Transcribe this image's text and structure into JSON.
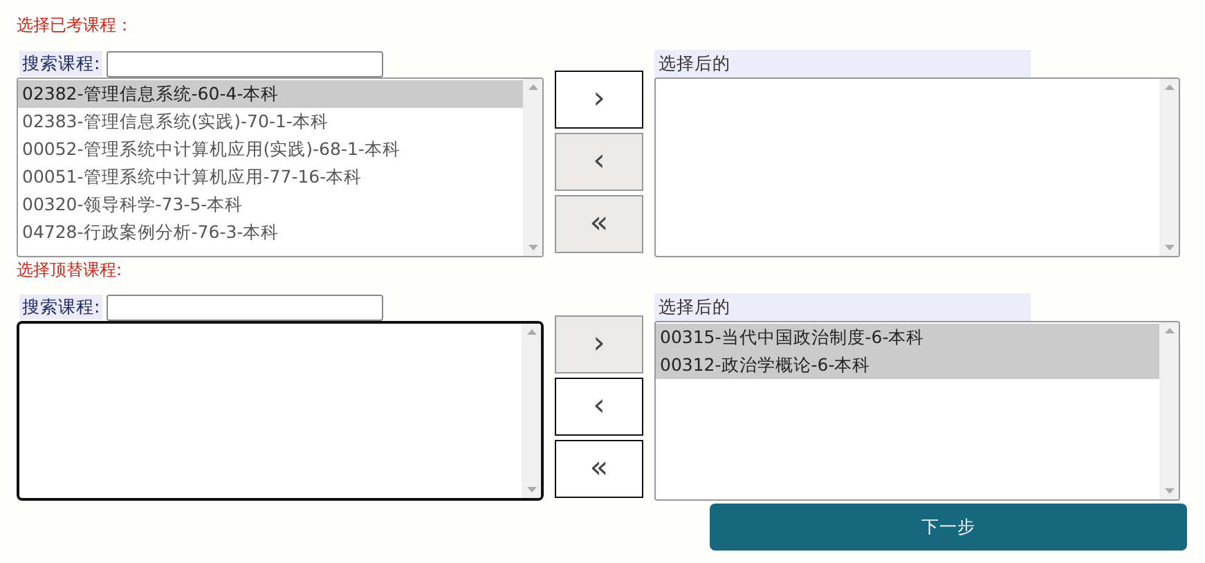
{
  "sections": [
    {
      "heading": "选择已考课程：",
      "search": {
        "label": "搜索课程:"
      },
      "source": {
        "focused": false,
        "items": [
          {
            "text": "02382-管理信息系统-60-4-本科",
            "selected": true
          },
          {
            "text": "02383-管理信息系统(实践)-70-1-本科",
            "selected": false
          },
          {
            "text": "00052-管理系统中计算机应用(实践)-68-1-本科",
            "selected": false
          },
          {
            "text": "00051-管理系统中计算机应用-77-16-本科",
            "selected": false
          },
          {
            "text": "00320-领导科学-73-5-本科",
            "selected": false
          },
          {
            "text": "04728-行政案例分析-76-3-本科",
            "selected": false
          }
        ]
      },
      "buttons": [
        {
          "label": "›",
          "disabled": false
        },
        {
          "label": "‹",
          "disabled": true
        },
        {
          "label": "«",
          "disabled": true
        }
      ],
      "target": {
        "label": "选择后的",
        "focused": false
      }
    },
    {
      "heading": "选择顶替课程:",
      "search": {
        "label": "搜索课程:"
      },
      "source": {
        "focused": true
      },
      "buttons": [
        {
          "label": "›",
          "disabled": true
        },
        {
          "label": "‹",
          "disabled": false
        },
        {
          "label": "«",
          "disabled": false
        }
      ],
      "target": {
        "label": "选择后的",
        "focused": false,
        "items": [
          {
            "text": "00315-当代中国政治制度-6-本科",
            "selected": true
          },
          {
            "text": "00312-政治学概论-6-本科",
            "selected": true
          }
        ]
      }
    }
  ],
  "next_button": {
    "label": "下一步"
  }
}
